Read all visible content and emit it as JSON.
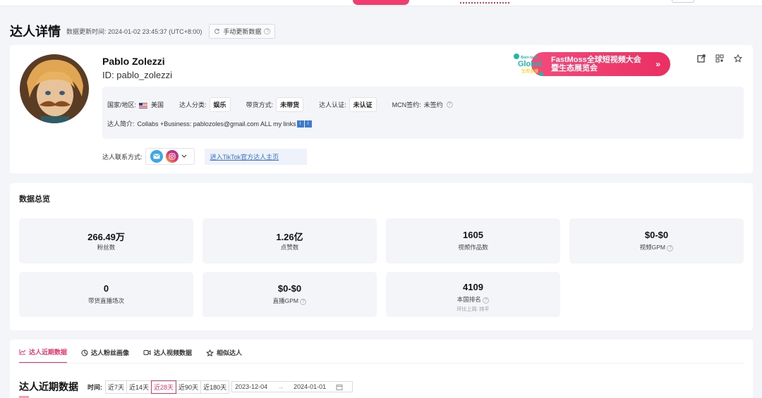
{
  "header": {
    "title": "达人详情",
    "updated_label": "数据更新时间:",
    "updated_time": "2024-01-02 23:45:37 (UTC+8:00)",
    "update_button": "手动更新数据"
  },
  "profile": {
    "name": "Pablo Zolezzi",
    "id_label": "ID:",
    "id_value": "pablo_zolezzi",
    "country_label": "国家/地区:",
    "country_value": "美国",
    "category_label": "达人分类:",
    "category_value": "娱乐",
    "sales_label": "带货方式:",
    "sales_value": "未带货",
    "auth_label": "达人认证:",
    "auth_value": "未认证",
    "mcn_label": "MCN签约:",
    "mcn_value": "未签约",
    "bio_label": "达人简介:",
    "bio_value": "Collabs +Business: pablozoles@gmail.com ALL my links",
    "contact_label": "达人联系方式:",
    "tiktok_link": "进入TikTok官方达人主页"
  },
  "banner": {
    "logo_top": "Born to Be",
    "logo_main": "Global",
    "logo_cn": "生而全球",
    "line1": "FastMoss全球短视频大会",
    "line2": "暨生态展览会"
  },
  "overview": {
    "title": "数据总览",
    "stats": [
      {
        "value": "266.49万",
        "label": "粉丝数"
      },
      {
        "value": "1.26亿",
        "label": "点赞数"
      },
      {
        "value": "1605",
        "label": "视频作品数"
      },
      {
        "value": "$0-$0",
        "label": "视频GPM"
      },
      {
        "value": "0",
        "label": "带货直播场次"
      },
      {
        "value": "$0-$0",
        "label": "直播GPM"
      },
      {
        "value": "4109",
        "label": "本国排名",
        "sub": "环比上周: 持平"
      }
    ]
  },
  "tabs": [
    {
      "label": "达人近期数据",
      "icon": "trend-icon"
    },
    {
      "label": "达人粉丝画像",
      "icon": "pie-icon"
    },
    {
      "label": "达人视频数据",
      "icon": "video-icon"
    },
    {
      "label": "相似达人",
      "icon": "similar-icon"
    }
  ],
  "recent": {
    "title": "达人近期数据",
    "time_label": "时间:",
    "ranges": [
      "近7天",
      "近14天",
      "近28天",
      "近90天",
      "近180天"
    ],
    "selected_range": "近28天",
    "start_date": "2023-12-04",
    "end_date": "2024-01-01",
    "date_sep": "→"
  },
  "colors": {
    "accent": "#e8336a",
    "link": "#3a6fd0",
    "panel": "#f4f5f8"
  }
}
